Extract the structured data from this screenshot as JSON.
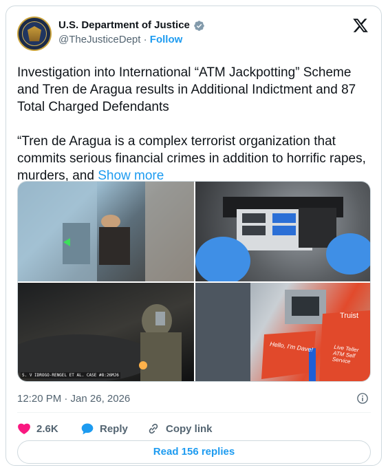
{
  "author": {
    "name": "U.S. Department of Justice",
    "handle": "@TheJusticeDept",
    "separator": "·",
    "follow_label": "Follow"
  },
  "tweet": {
    "paragraph1": "Investigation into International “ATM Jackpotting” Scheme and Tren de Aragua results in Additional Indictment and 87 Total Charged Defendants",
    "paragraph2": "“Tren de Aragua is a complex terrorist organization that commits serious financial crimes in addition to horrific rapes, murders, and ",
    "show_more": "Show more"
  },
  "media": {
    "image3_caption": "S. V IDROGO-RENGEL ET AL. CASE #8:26MJ6",
    "image4_sign_1": "Hello, I'm Dave!",
    "image4_sign_2": "Live Teller ATM Self Service",
    "image4_brand": "Truist"
  },
  "meta": {
    "timestamp": "12:20 PM · Jan 26, 2026"
  },
  "actions": {
    "likes": "2.6K",
    "reply_label": "Reply",
    "copy_label": "Copy link"
  },
  "replies_button": "Read 156 replies",
  "colors": {
    "accent": "#1d9bf0",
    "like": "#f91880",
    "text": "#0f1419",
    "muted": "#536471"
  }
}
